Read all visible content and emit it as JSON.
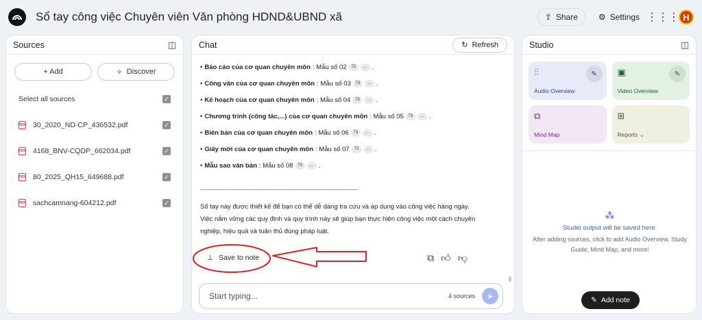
{
  "header": {
    "title": "Sổ tay công việc Chuyên viên Văn phòng HDND&UBND xã",
    "share_label": "Share",
    "settings_label": "Settings",
    "avatar_letter": "H"
  },
  "sources": {
    "title": "Sources",
    "add_label": "+ Add",
    "discover_label": "Discover",
    "select_all_label": "Select all sources",
    "files": [
      "30_2020_ND-CP_436532.pdf",
      "4168_BNV-CQDP_662034.pdf",
      "80_2025_QH15_649688.pdf",
      "sachcamnang-604212.pdf"
    ]
  },
  "chat": {
    "title": "Chat",
    "refresh_label": "Refresh",
    "lines": [
      {
        "bold": "Báo cáo của cơ quan chuyên môn",
        "rest": ": Mẫu số 02",
        "cite": "72"
      },
      {
        "bold": "Công văn của cơ quan chuyên môn",
        "rest": ": Mẫu số 03",
        "cite": "73"
      },
      {
        "bold": "Kế hoạch của cơ quan chuyên môn",
        "rest": ": Mẫu số 04",
        "cite": "73"
      },
      {
        "bold": "Chương trình (công tác,...) của cơ quan chuyên môn",
        "rest": ": Mẫu số 05",
        "cite": "73"
      },
      {
        "bold": "Biên bản của cơ quan chuyên môn",
        "rest": ": Mẫu số 06",
        "cite": "73"
      },
      {
        "bold": "Giấy mời của cơ quan chuyên môn",
        "rest": ": Mẫu số 07",
        "cite": "73"
      },
      {
        "bold": "Mẫu sao văn bản",
        "rest": ": Mẫu số 08",
        "cite": "73"
      }
    ],
    "more_cite": "...",
    "divider": "--------------------------------------------------------------------------------------------",
    "paragraph_1": "Sổ tay này được thiết kế để bạn có thể dễ dàng tra cứu và áp dụng vào công việc hàng ngày.",
    "paragraph_2": "Việc nắm vững các quy định và quy trình này sẽ giúp bạn thực hiện công việc một cách chuyên nghiệp, hiệu quả và tuân thủ đúng pháp luật.",
    "save_note_label": "Save to note",
    "input_placeholder": "Start typing...",
    "source_count": "4 sources"
  },
  "studio": {
    "title": "Studio",
    "cards": {
      "audio": "Audio Overview",
      "video": "Video Overview",
      "mind": "Mind Map",
      "reports": "Reports"
    },
    "empty_title": "Studio output will be saved here.",
    "empty_desc": "After adding sources, click to add Audio Overview, Study Guide, Mind Map, and more!",
    "add_note_label": "Add note"
  },
  "colors": {
    "annotation": "#e02020",
    "accent": "#3b5bd9"
  }
}
